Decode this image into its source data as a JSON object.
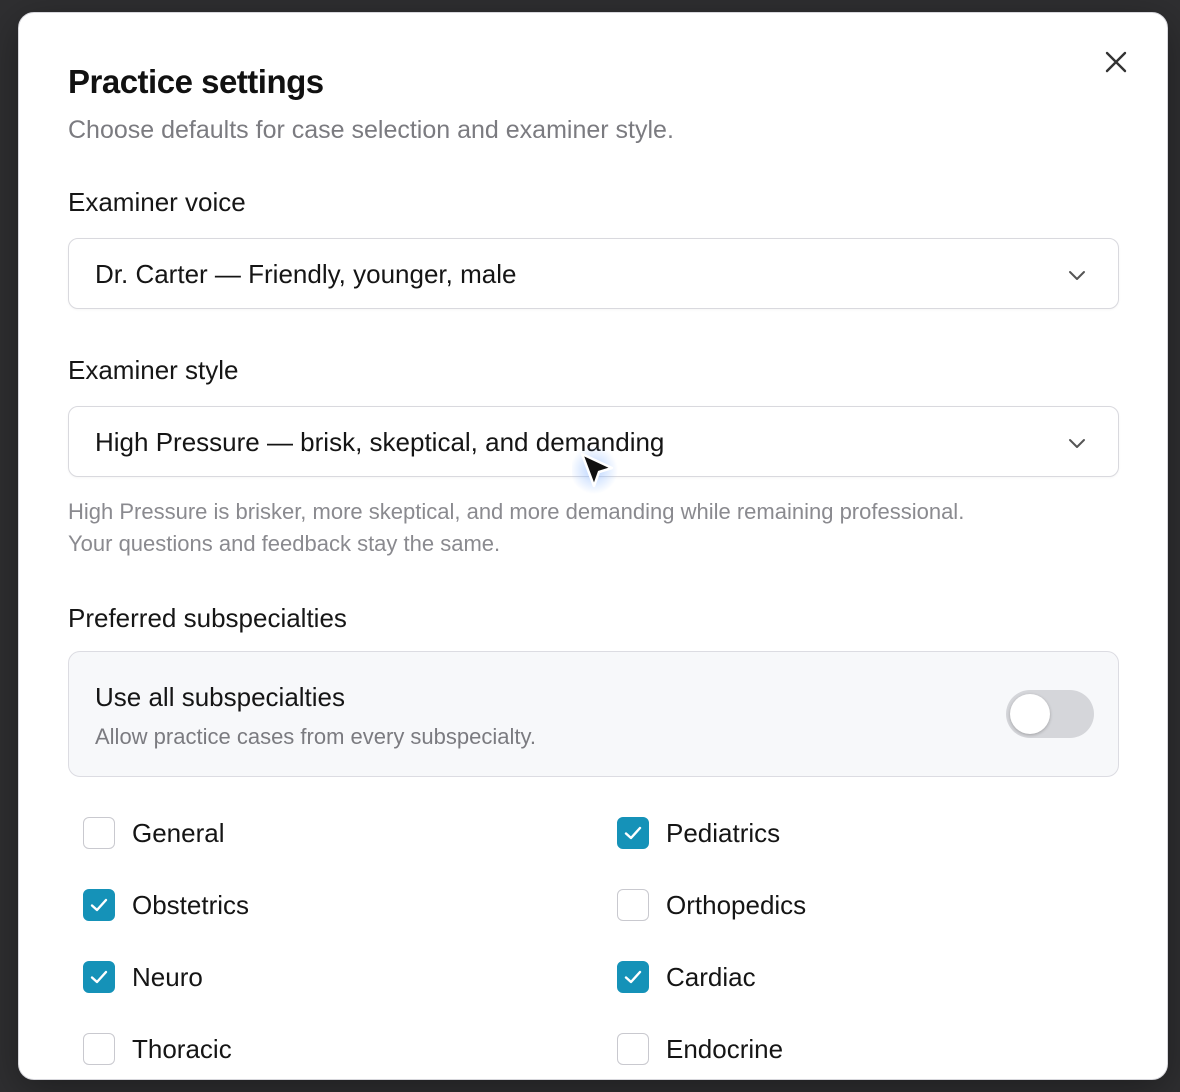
{
  "modal": {
    "title": "Practice settings",
    "subtitle": "Choose defaults for case selection and examiner style.",
    "close_icon": "close-icon"
  },
  "examiner_voice": {
    "label": "Examiner voice",
    "value": "Dr. Carter — Friendly, younger, male"
  },
  "examiner_style": {
    "label": "Examiner style",
    "value": "High Pressure — brisk, skeptical, and demanding",
    "help_line1": "High Pressure is brisker, more skeptical, and more demanding while remaining professional.",
    "help_line2": "Your questions and feedback stay the same."
  },
  "subspecialties": {
    "label": "Preferred subspecialties",
    "use_all": {
      "title": "Use all subspecialties",
      "description": "Allow practice cases from every subspecialty.",
      "enabled": false
    },
    "items": [
      {
        "label": "General",
        "checked": false
      },
      {
        "label": "Pediatrics",
        "checked": true
      },
      {
        "label": "Obstetrics",
        "checked": true
      },
      {
        "label": "Orthopedics",
        "checked": false
      },
      {
        "label": "Neuro",
        "checked": true
      },
      {
        "label": "Cardiac",
        "checked": true
      },
      {
        "label": "Thoracic",
        "checked": false
      },
      {
        "label": "Endocrine",
        "checked": false
      }
    ]
  },
  "colors": {
    "accent": "#1592b8",
    "toggle_off": "#d5d6da"
  }
}
